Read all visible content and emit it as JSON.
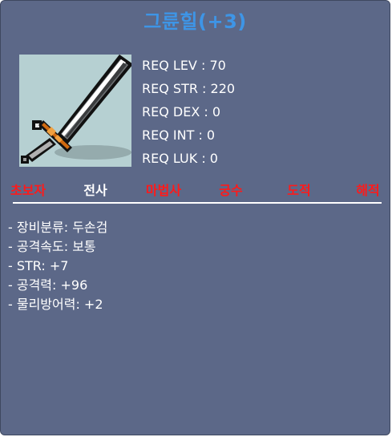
{
  "item": {
    "name": "그륜힐(+3)",
    "icon": "two-handed-sword-icon",
    "name_color": "#3e95e6"
  },
  "requirements": [
    "REQ LEV : 70",
    "REQ STR : 220",
    "REQ DEX : 0",
    "REQ INT : 0",
    "REQ LUK : 0"
  ],
  "jobs": [
    {
      "label": "초보자",
      "usable": false
    },
    {
      "label": "전사",
      "usable": true
    },
    {
      "label": "마법사",
      "usable": false
    },
    {
      "label": "궁수",
      "usable": false
    },
    {
      "label": "도적",
      "usable": false
    },
    {
      "label": "해적",
      "usable": false
    }
  ],
  "colors": {
    "panel_bg": "#5c6888",
    "unusable_job": "#ff1a1a",
    "usable_job": "#ffffff"
  },
  "stats": [
    "- 장비분류: 두손검",
    "- 공격속도: 보통",
    "- STR: +7",
    "- 공격력: +96",
    "- 물리방어력: +2"
  ]
}
